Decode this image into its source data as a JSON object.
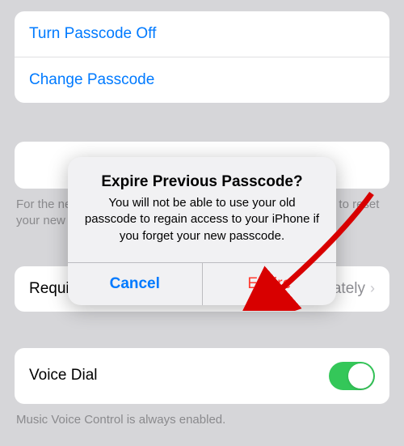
{
  "passcode_group": {
    "turn_off": "Turn Passcode Off",
    "change": "Change Passcode"
  },
  "footer_prev": "For the next 72 hours, your previous passcode can be used to reset your new passcode if you forget it.",
  "require_row": {
    "label": "Require Passcode",
    "value": "Immediately"
  },
  "voice_dial": {
    "label": "Voice Dial",
    "footer": "Music Voice Control is always enabled."
  },
  "dialog": {
    "title": "Expire Previous Passcode?",
    "message": "You will not be able to use your old passcode to regain access to your iPhone if you forget your new passcode.",
    "cancel": "Cancel",
    "expire": "Expire"
  }
}
